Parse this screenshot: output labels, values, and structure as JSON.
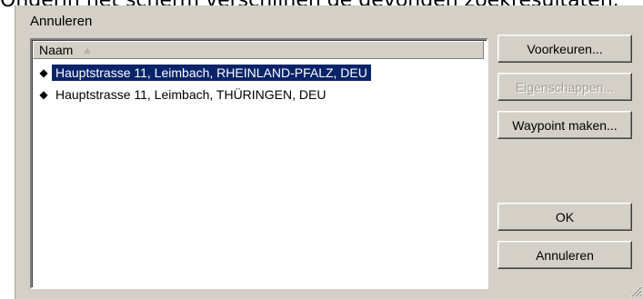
{
  "intro_text": "Onderin het scherm verschijnen de gevonden zoekresultaten.",
  "dialog": {
    "group_label": "Annuleren",
    "list": {
      "column_header": "Naam",
      "items": [
        {
          "label": "Hauptstrasse 11, Leimbach, RHEINLAND-PFALZ, DEU",
          "selected": true
        },
        {
          "label": "Hauptstrasse 11, Leimbach, THÜRINGEN, DEU",
          "selected": false
        }
      ]
    },
    "buttons": {
      "preferences": "Voorkeuren...",
      "properties": "Eigenschappen...",
      "make_waypoint": "Waypoint maken...",
      "ok": "OK",
      "cancel": "Annuleren"
    }
  },
  "colors": {
    "dialog_bg": "#d4d0c8",
    "selection": "#0a246a",
    "disabled_text": "#a19e97"
  },
  "icons": [
    "sort-ascending-icon",
    "bullet-icon",
    "resize-grip-icon"
  ]
}
